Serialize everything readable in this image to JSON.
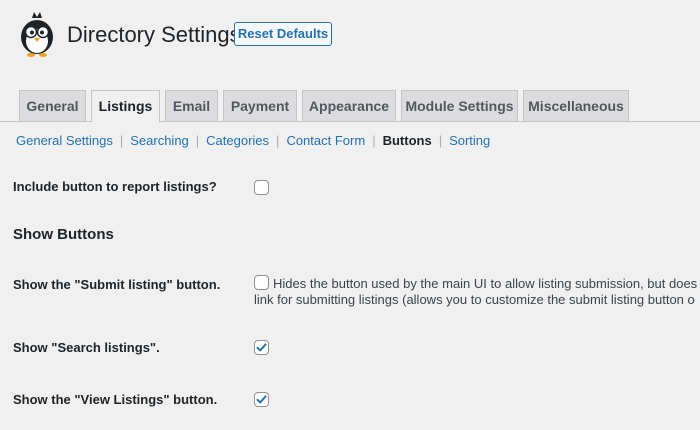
{
  "header": {
    "title": "Directory Settings",
    "reset_label": "Reset Defaults"
  },
  "tabs": [
    {
      "label": "General",
      "active": false
    },
    {
      "label": "Listings",
      "active": true
    },
    {
      "label": "Email",
      "active": false
    },
    {
      "label": "Payment",
      "active": false
    },
    {
      "label": "Appearance",
      "active": false
    },
    {
      "label": "Module Settings",
      "active": false
    },
    {
      "label": "Miscellaneous",
      "active": false
    }
  ],
  "subnav": {
    "items": [
      "General Settings",
      "Searching",
      "Categories",
      "Contact Form",
      "Buttons",
      "Sorting"
    ],
    "current": "Buttons",
    "separator": "|"
  },
  "settings": {
    "report_label": "Include button to report listings?",
    "report_checked": false,
    "section_heading": "Show Buttons",
    "submit_label": "Show the \"Submit listing\" button.",
    "submit_checked": false,
    "submit_desc_line1": "Hides the button used by the main UI to allow listing submission, but does",
    "submit_desc_line2": "link for submitting listings (allows you to customize the submit listing button o",
    "search_label": "Show \"Search listings\".",
    "search_checked": true,
    "view_label": "Show the \"View Listings\" button.",
    "view_checked": true
  },
  "colors": {
    "accent": "#2271b1",
    "background": "#f0f0f1",
    "tab_inactive": "#dcdcde",
    "checkmark": "#2271b1"
  },
  "icons": {
    "logo": "penguin-logo-icon",
    "check": "checkmark-icon"
  }
}
